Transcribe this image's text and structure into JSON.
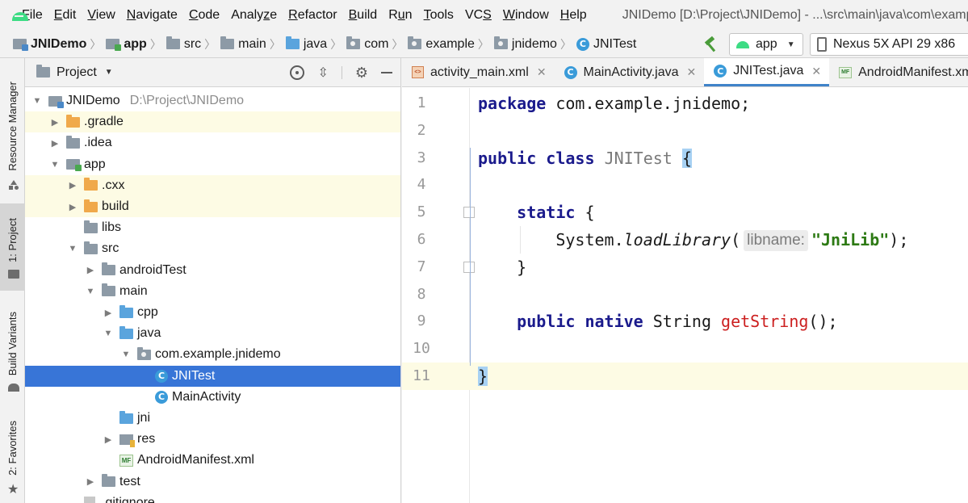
{
  "menubar": {
    "items": [
      {
        "label": "File",
        "mnemonic": "F"
      },
      {
        "label": "Edit",
        "mnemonic": "E"
      },
      {
        "label": "View",
        "mnemonic": "V"
      },
      {
        "label": "Navigate",
        "mnemonic": "N"
      },
      {
        "label": "Code",
        "mnemonic": "C"
      },
      {
        "label": "Analyze",
        "mnemonic": "z"
      },
      {
        "label": "Refactor",
        "mnemonic": "R"
      },
      {
        "label": "Build",
        "mnemonic": "B"
      },
      {
        "label": "Run",
        "mnemonic": "u"
      },
      {
        "label": "Tools",
        "mnemonic": "T"
      },
      {
        "label": "VCS",
        "mnemonic": "S"
      },
      {
        "label": "Window",
        "mnemonic": "W"
      },
      {
        "label": "Help",
        "mnemonic": "H"
      }
    ],
    "window_title": "JNIDemo [D:\\Project\\JNIDemo] - ...\\src\\main\\java\\com\\example\\jnidemo\\JNITest.java [app] - Android Studio"
  },
  "navbar": {
    "crumbs": [
      "JNIDemo",
      "app",
      "src",
      "main",
      "java",
      "com",
      "example",
      "jnidemo",
      "JNITest"
    ],
    "run_config": "app",
    "device": "Nexus 5X API 29 x86"
  },
  "toolstrip": {
    "resource_manager": "Resource Manager",
    "project": "1: Project",
    "build_variants": "Build Variants",
    "favorites": "2: Favorites"
  },
  "project_panel": {
    "title": "Project",
    "tree": [
      {
        "label": "JNIDemo",
        "sub": "D:\\Project\\JNIDemo",
        "depth": 0,
        "arrow": "down",
        "icon": "project",
        "highlight": false,
        "selected": false
      },
      {
        "label": ".gradle",
        "depth": 1,
        "arrow": "right",
        "icon": "folder-orange",
        "highlight": true,
        "selected": false
      },
      {
        "label": ".idea",
        "depth": 1,
        "arrow": "right",
        "icon": "folder",
        "highlight": false,
        "selected": false
      },
      {
        "label": "app",
        "depth": 1,
        "arrow": "down",
        "icon": "module",
        "highlight": false,
        "selected": false
      },
      {
        "label": ".cxx",
        "depth": 2,
        "arrow": "right",
        "icon": "folder-orange",
        "highlight": true,
        "selected": false
      },
      {
        "label": "build",
        "depth": 2,
        "arrow": "right",
        "icon": "folder-orange",
        "highlight": true,
        "selected": false
      },
      {
        "label": "libs",
        "depth": 2,
        "arrow": "none",
        "icon": "folder",
        "highlight": false,
        "selected": false
      },
      {
        "label": "src",
        "depth": 2,
        "arrow": "down",
        "icon": "folder",
        "highlight": false,
        "selected": false
      },
      {
        "label": "androidTest",
        "depth": 3,
        "arrow": "right",
        "icon": "folder",
        "highlight": false,
        "selected": false
      },
      {
        "label": "main",
        "depth": 3,
        "arrow": "down",
        "icon": "folder",
        "highlight": false,
        "selected": false
      },
      {
        "label": "cpp",
        "depth": 4,
        "arrow": "right",
        "icon": "folder-blue",
        "highlight": false,
        "selected": false
      },
      {
        "label": "java",
        "depth": 4,
        "arrow": "down",
        "icon": "folder-blue",
        "highlight": false,
        "selected": false
      },
      {
        "label": "com.example.jnidemo",
        "depth": 5,
        "arrow": "down",
        "icon": "package",
        "highlight": false,
        "selected": false
      },
      {
        "label": "JNITest",
        "depth": 6,
        "arrow": "none",
        "icon": "class",
        "highlight": false,
        "selected": true
      },
      {
        "label": "MainActivity",
        "depth": 6,
        "arrow": "none",
        "icon": "class",
        "highlight": false,
        "selected": false
      },
      {
        "label": "jni",
        "depth": 4,
        "arrow": "none",
        "icon": "folder-blue",
        "highlight": false,
        "selected": false
      },
      {
        "label": "res",
        "depth": 4,
        "arrow": "right",
        "icon": "res",
        "highlight": false,
        "selected": false
      },
      {
        "label": "AndroidManifest.xml",
        "depth": 4,
        "arrow": "none",
        "icon": "manifest",
        "highlight": false,
        "selected": false
      },
      {
        "label": "test",
        "depth": 3,
        "arrow": "right",
        "icon": "folder",
        "highlight": false,
        "selected": false
      },
      {
        "label": ".gitignore",
        "depth": 2,
        "arrow": "none",
        "icon": "file",
        "highlight": false,
        "selected": false
      }
    ]
  },
  "editor": {
    "tabs": [
      {
        "label": "activity_main.xml",
        "icon": "xml",
        "active": false
      },
      {
        "label": "MainActivity.java",
        "icon": "class",
        "active": false
      },
      {
        "label": "JNITest.java",
        "icon": "class",
        "active": true
      },
      {
        "label": "AndroidManifest.xml",
        "icon": "manifest",
        "active": false
      }
    ],
    "current_line": 11,
    "lines": [
      [
        {
          "t": "package",
          "c": "kw"
        },
        {
          "t": " com.example.jnidemo;",
          "c": ""
        }
      ],
      [],
      [
        {
          "t": "public",
          "c": "kw"
        },
        {
          "t": " ",
          "c": ""
        },
        {
          "t": "class",
          "c": "kw"
        },
        {
          "t": " ",
          "c": ""
        },
        {
          "t": "JNITest",
          "c": "unused"
        },
        {
          "t": " ",
          "c": ""
        },
        {
          "t": "{",
          "c": "brace-m"
        }
      ],
      [],
      [
        {
          "t": "    ",
          "c": ""
        },
        {
          "t": "static",
          "c": "kw"
        },
        {
          "t": " {",
          "c": ""
        }
      ],
      [
        {
          "t": "        System.",
          "c": ""
        },
        {
          "t": "loadLibrary",
          "c": "fn-italic"
        },
        {
          "t": "(",
          "c": ""
        },
        {
          "t": "libname:",
          "c": "hint"
        },
        {
          "t": "\"JniLib\"",
          "c": "str"
        },
        {
          "t": ");",
          "c": ""
        }
      ],
      [
        {
          "t": "    }",
          "c": ""
        }
      ],
      [],
      [
        {
          "t": "    ",
          "c": ""
        },
        {
          "t": "public",
          "c": "kw"
        },
        {
          "t": " ",
          "c": ""
        },
        {
          "t": "native",
          "c": "kw"
        },
        {
          "t": " String ",
          "c": ""
        },
        {
          "t": "getString",
          "c": "decl"
        },
        {
          "t": "();",
          "c": ""
        }
      ],
      [],
      [
        {
          "t": "}",
          "c": "brace-m"
        }
      ]
    ]
  },
  "colors": {
    "selection": "#3875d7",
    "keyword": "#1a1a8c",
    "string": "#2d7a14",
    "declaration": "#cc1f1f",
    "caret_row": "#fdfbe4"
  }
}
